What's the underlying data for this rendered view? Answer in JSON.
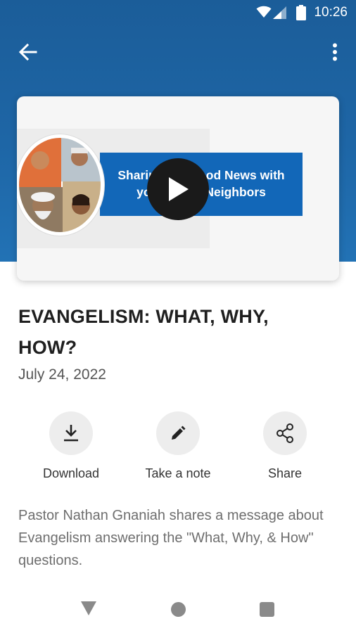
{
  "status_bar": {
    "time": "10:26",
    "icons": [
      "wifi-icon",
      "signal-icon",
      "battery-icon"
    ]
  },
  "app_bar": {
    "back_icon": "arrow-left-icon",
    "menu_icon": "more-vertical-icon"
  },
  "video": {
    "thumbnail_text": "Sharing the Good News with your Hindu Neighbors",
    "play_icon": "play-icon"
  },
  "sermon": {
    "title": "EVANGELISM: WHAT, WHY, HOW?",
    "date": "July 24, 2022",
    "description": "Pastor Nathan Gnaniah shares a message about Evangelism answering the \"What, Why, & How\" questions."
  },
  "actions": [
    {
      "label": "Download",
      "icon": "download-icon"
    },
    {
      "label": "Take a note",
      "icon": "pencil-icon"
    },
    {
      "label": "Share",
      "icon": "share-icon"
    }
  ],
  "colors": {
    "header": "#1e66a6",
    "banner": "#1267b8",
    "title_text": "#1f1f1f",
    "secondary_text": "#6e6e6e"
  }
}
